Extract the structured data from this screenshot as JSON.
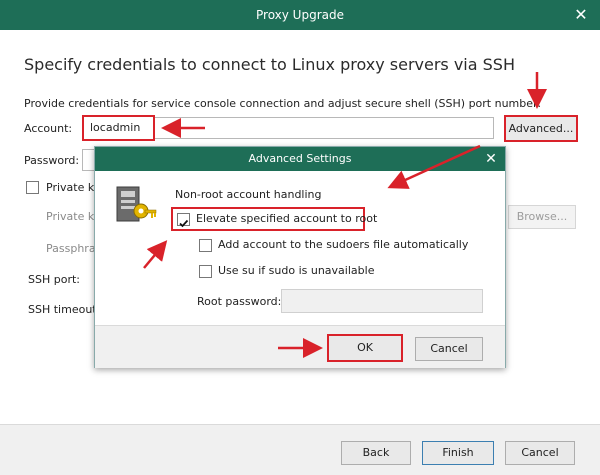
{
  "window": {
    "title": "Proxy Upgrade",
    "close_icon": "close-icon"
  },
  "main": {
    "heading": "Specify credentials to connect to Linux proxy servers via SSH",
    "instruction": "Provide credentials for service console connection and adjust secure shell (SSH) port number:",
    "account_label": "Account:",
    "account_value": "locadmin",
    "advanced_label": "Advanced...",
    "password_label": "Password:",
    "private_key_label": "Private ke",
    "private_key_field_label": "Private ke",
    "passphrase_label": "Passphras",
    "browse_label": "Browse...",
    "ssh_port_label": "SSH port:",
    "ssh_timeout_label": "SSH timeout"
  },
  "footer": {
    "back_label": "Back",
    "finish_label": "Finish",
    "cancel_label": "Cancel"
  },
  "advanced_dialog": {
    "title": "Advanced Settings",
    "section_label": "Non-root account handling",
    "elevate_label": "Elevate specified account to root",
    "elevate_checked": true,
    "sudoers_label": "Add account to the sudoers file automatically",
    "sudoers_checked": false,
    "su_label": "Use su if sudo is unavailable",
    "su_checked": false,
    "root_password_label": "Root password:",
    "root_password_value": "",
    "ok_label": "OK",
    "cancel_label": "Cancel"
  },
  "colors": {
    "titlebar": "#1e6e57",
    "highlight": "#d9222a"
  }
}
